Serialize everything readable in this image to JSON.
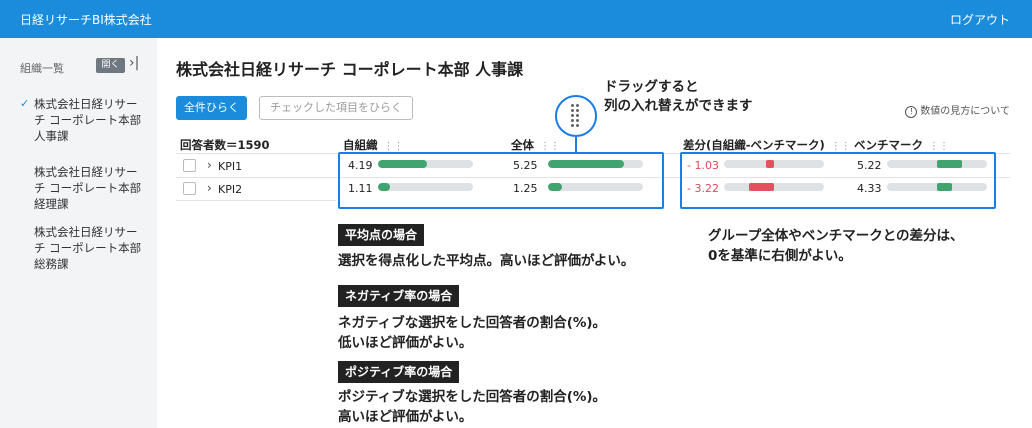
{
  "header": {
    "brand": "日経リサーチBI株式会社",
    "logout": "ログアウト"
  },
  "sidebar": {
    "title": "組織一覧",
    "open_label": "開く",
    "collapse_icon": "collapse-icon",
    "items": [
      {
        "label": "株式会社日経リサーチ コーポレート本部 人事課",
        "selected": true
      },
      {
        "label": "株式会社日経リサーチ コーポレート本部 経理課",
        "selected": false
      },
      {
        "label": "株式会社日経リサーチ コーポレート本部 総務課",
        "selected": false
      }
    ]
  },
  "main": {
    "title": "株式会社日経リサーチ コーポレート本部 人事課",
    "expand_all": "全件ひらく",
    "expand_checked": "チェックした項目をひらく",
    "help": "数値の見方について",
    "respondents": "回答者数＝1590",
    "columns": {
      "own": "自組織",
      "all": "全体",
      "diff": "差分(自組織-ベンチマーク)",
      "benchmark": "ベンチマーク"
    },
    "rows": [
      {
        "name": "KPI1",
        "own": "4.19",
        "own_level": 0.52,
        "all": "5.25",
        "all_level": 0.8,
        "diff": "- 1.03",
        "diff_level": -0.08,
        "bench": "5.22",
        "bench_level": 0.25
      },
      {
        "name": "KPI2",
        "own": "1.11",
        "own_level": 0.13,
        "all": "1.25",
        "all_level": 0.15,
        "diff": "- 3.22",
        "diff_level": -0.25,
        "bench": "4.33",
        "bench_level": 0.15
      }
    ]
  },
  "annotations": {
    "drag": [
      "ドラッグすると",
      "列の入れ替えができます"
    ],
    "avg_tag": "平均点の場合",
    "avg_desc": "選択を得点化した平均点。高いほど評価がよい。",
    "neg_tag": "ネガティブ率の場合",
    "neg_desc": [
      "ネガティブな選択をした回答者の割合(%)。",
      "低いほど評価がよい。"
    ],
    "pos_tag": "ポジティブ率の場合",
    "pos_desc": [
      "ポジティブな選択をした回答者の割合(%)。",
      "高いほど評価がよい。"
    ],
    "diff_note": [
      "グループ全体やベンチマークとの差分は、",
      "0を基準に右側がよい。"
    ]
  },
  "colors": {
    "primary": "#1b8cdb",
    "positive": "#3fa46f",
    "negative": "#e64f5d",
    "highlight": "#1b7ee6"
  }
}
